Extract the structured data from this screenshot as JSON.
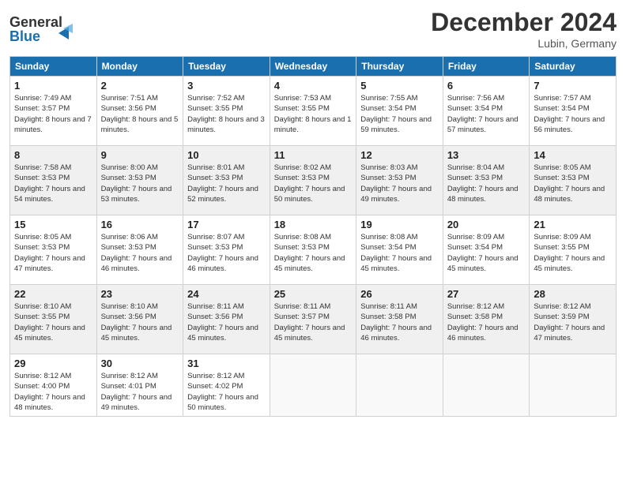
{
  "header": {
    "logo_line1": "General",
    "logo_line2": "Blue",
    "month": "December 2024",
    "location": "Lubin, Germany"
  },
  "days_of_week": [
    "Sunday",
    "Monday",
    "Tuesday",
    "Wednesday",
    "Thursday",
    "Friday",
    "Saturday"
  ],
  "weeks": [
    [
      {
        "day": "1",
        "sunrise": "Sunrise: 7:49 AM",
        "sunset": "Sunset: 3:57 PM",
        "daylight": "Daylight: 8 hours and 7 minutes."
      },
      {
        "day": "2",
        "sunrise": "Sunrise: 7:51 AM",
        "sunset": "Sunset: 3:56 PM",
        "daylight": "Daylight: 8 hours and 5 minutes."
      },
      {
        "day": "3",
        "sunrise": "Sunrise: 7:52 AM",
        "sunset": "Sunset: 3:55 PM",
        "daylight": "Daylight: 8 hours and 3 minutes."
      },
      {
        "day": "4",
        "sunrise": "Sunrise: 7:53 AM",
        "sunset": "Sunset: 3:55 PM",
        "daylight": "Daylight: 8 hours and 1 minute."
      },
      {
        "day": "5",
        "sunrise": "Sunrise: 7:55 AM",
        "sunset": "Sunset: 3:54 PM",
        "daylight": "Daylight: 7 hours and 59 minutes."
      },
      {
        "day": "6",
        "sunrise": "Sunrise: 7:56 AM",
        "sunset": "Sunset: 3:54 PM",
        "daylight": "Daylight: 7 hours and 57 minutes."
      },
      {
        "day": "7",
        "sunrise": "Sunrise: 7:57 AM",
        "sunset": "Sunset: 3:54 PM",
        "daylight": "Daylight: 7 hours and 56 minutes."
      }
    ],
    [
      {
        "day": "8",
        "sunrise": "Sunrise: 7:58 AM",
        "sunset": "Sunset: 3:53 PM",
        "daylight": "Daylight: 7 hours and 54 minutes."
      },
      {
        "day": "9",
        "sunrise": "Sunrise: 8:00 AM",
        "sunset": "Sunset: 3:53 PM",
        "daylight": "Daylight: 7 hours and 53 minutes."
      },
      {
        "day": "10",
        "sunrise": "Sunrise: 8:01 AM",
        "sunset": "Sunset: 3:53 PM",
        "daylight": "Daylight: 7 hours and 52 minutes."
      },
      {
        "day": "11",
        "sunrise": "Sunrise: 8:02 AM",
        "sunset": "Sunset: 3:53 PM",
        "daylight": "Daylight: 7 hours and 50 minutes."
      },
      {
        "day": "12",
        "sunrise": "Sunrise: 8:03 AM",
        "sunset": "Sunset: 3:53 PM",
        "daylight": "Daylight: 7 hours and 49 minutes."
      },
      {
        "day": "13",
        "sunrise": "Sunrise: 8:04 AM",
        "sunset": "Sunset: 3:53 PM",
        "daylight": "Daylight: 7 hours and 48 minutes."
      },
      {
        "day": "14",
        "sunrise": "Sunrise: 8:05 AM",
        "sunset": "Sunset: 3:53 PM",
        "daylight": "Daylight: 7 hours and 48 minutes."
      }
    ],
    [
      {
        "day": "15",
        "sunrise": "Sunrise: 8:05 AM",
        "sunset": "Sunset: 3:53 PM",
        "daylight": "Daylight: 7 hours and 47 minutes."
      },
      {
        "day": "16",
        "sunrise": "Sunrise: 8:06 AM",
        "sunset": "Sunset: 3:53 PM",
        "daylight": "Daylight: 7 hours and 46 minutes."
      },
      {
        "day": "17",
        "sunrise": "Sunrise: 8:07 AM",
        "sunset": "Sunset: 3:53 PM",
        "daylight": "Daylight: 7 hours and 46 minutes."
      },
      {
        "day": "18",
        "sunrise": "Sunrise: 8:08 AM",
        "sunset": "Sunset: 3:53 PM",
        "daylight": "Daylight: 7 hours and 45 minutes."
      },
      {
        "day": "19",
        "sunrise": "Sunrise: 8:08 AM",
        "sunset": "Sunset: 3:54 PM",
        "daylight": "Daylight: 7 hours and 45 minutes."
      },
      {
        "day": "20",
        "sunrise": "Sunrise: 8:09 AM",
        "sunset": "Sunset: 3:54 PM",
        "daylight": "Daylight: 7 hours and 45 minutes."
      },
      {
        "day": "21",
        "sunrise": "Sunrise: 8:09 AM",
        "sunset": "Sunset: 3:55 PM",
        "daylight": "Daylight: 7 hours and 45 minutes."
      }
    ],
    [
      {
        "day": "22",
        "sunrise": "Sunrise: 8:10 AM",
        "sunset": "Sunset: 3:55 PM",
        "daylight": "Daylight: 7 hours and 45 minutes."
      },
      {
        "day": "23",
        "sunrise": "Sunrise: 8:10 AM",
        "sunset": "Sunset: 3:56 PM",
        "daylight": "Daylight: 7 hours and 45 minutes."
      },
      {
        "day": "24",
        "sunrise": "Sunrise: 8:11 AM",
        "sunset": "Sunset: 3:56 PM",
        "daylight": "Daylight: 7 hours and 45 minutes."
      },
      {
        "day": "25",
        "sunrise": "Sunrise: 8:11 AM",
        "sunset": "Sunset: 3:57 PM",
        "daylight": "Daylight: 7 hours and 45 minutes."
      },
      {
        "day": "26",
        "sunrise": "Sunrise: 8:11 AM",
        "sunset": "Sunset: 3:58 PM",
        "daylight": "Daylight: 7 hours and 46 minutes."
      },
      {
        "day": "27",
        "sunrise": "Sunrise: 8:12 AM",
        "sunset": "Sunset: 3:58 PM",
        "daylight": "Daylight: 7 hours and 46 minutes."
      },
      {
        "day": "28",
        "sunrise": "Sunrise: 8:12 AM",
        "sunset": "Sunset: 3:59 PM",
        "daylight": "Daylight: 7 hours and 47 minutes."
      }
    ],
    [
      {
        "day": "29",
        "sunrise": "Sunrise: 8:12 AM",
        "sunset": "Sunset: 4:00 PM",
        "daylight": "Daylight: 7 hours and 48 minutes."
      },
      {
        "day": "30",
        "sunrise": "Sunrise: 8:12 AM",
        "sunset": "Sunset: 4:01 PM",
        "daylight": "Daylight: 7 hours and 49 minutes."
      },
      {
        "day": "31",
        "sunrise": "Sunrise: 8:12 AM",
        "sunset": "Sunset: 4:02 PM",
        "daylight": "Daylight: 7 hours and 50 minutes."
      },
      null,
      null,
      null,
      null
    ]
  ]
}
